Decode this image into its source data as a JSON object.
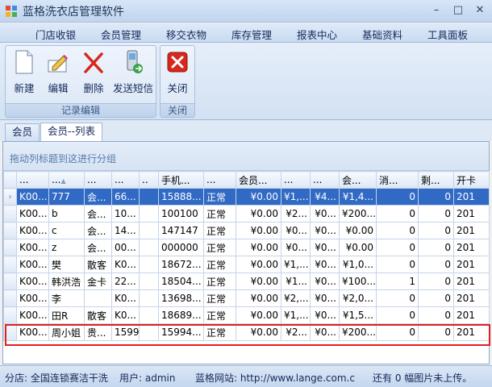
{
  "window": {
    "title": "蓝格洗衣店管理软件",
    "minimize": "–",
    "maximize": "□",
    "close": "✕"
  },
  "menu": [
    "门店收银",
    "会员管理",
    "移交衣物",
    "库存管理",
    "报表中心",
    "基础资料",
    "工具面板"
  ],
  "ribbon": {
    "groups": [
      {
        "label": "记录编辑",
        "buttons": [
          "新建",
          "编辑",
          "删除",
          "发送短信"
        ]
      },
      {
        "label": "关闭",
        "buttons": [
          "关闭"
        ]
      }
    ]
  },
  "tabs": [
    "会员",
    "会员--列表"
  ],
  "grid": {
    "group_hint": "拖动列标题到这进行分组",
    "columns": [
      "...",
      "...",
      "...",
      "...",
      "..",
      "手机...",
      "...",
      "会员...",
      "...",
      "...",
      "会...",
      "消...",
      "剩...",
      "开卡"
    ],
    "rows": [
      [
        "K00...",
        "777",
        "会...",
        "66...",
        "",
        "15888...",
        "正常",
        "¥0.00",
        "¥1,...",
        "¥4...",
        "¥1,4...",
        "0",
        "0",
        "201"
      ],
      [
        "K00...",
        "b",
        "会...",
        "10...",
        "",
        "100100",
        "正常",
        "¥0.00",
        "¥2...",
        "¥0...",
        "¥200...",
        "0",
        "0",
        "201"
      ],
      [
        "K00...",
        "c",
        "会...",
        "14...",
        "",
        "147147",
        "正常",
        "¥0.00",
        "¥0...",
        "¥0...",
        "¥0.00",
        "0",
        "0",
        "201"
      ],
      [
        "K00...",
        "z",
        "会...",
        "00...",
        "",
        "000000",
        "正常",
        "¥0.00",
        "¥0...",
        "¥0...",
        "¥0.00",
        "0",
        "0",
        "201"
      ],
      [
        "K00...",
        "樊",
        "散客",
        "K0...",
        "",
        "18672...",
        "正常",
        "¥0.00",
        "¥1,...",
        "¥0...",
        "¥1,0...",
        "0",
        "0",
        "201"
      ],
      [
        "K00...",
        "韩洪浩",
        "金卡",
        "22...",
        "",
        "18504...",
        "正常",
        "¥0.00",
        "¥1...",
        "¥0...",
        "¥100...",
        "1",
        "0",
        "201"
      ],
      [
        "K00...",
        "李",
        "",
        "K0...",
        "",
        "13698...",
        "正常",
        "¥0.00",
        "¥2,...",
        "¥0...",
        "¥2,0...",
        "0",
        "0",
        "201"
      ],
      [
        "K00...",
        "田R",
        "散客",
        "K0...",
        "",
        "18689...",
        "正常",
        "¥0.00",
        "¥1,...",
        "¥0...",
        "¥1,5...",
        "0",
        "0",
        "201"
      ],
      [
        "K00...",
        "周小姐",
        "贵...",
        "1599",
        "",
        "15994...",
        "正常",
        "¥0.00",
        "¥2...",
        "¥0...",
        "¥200...",
        "0",
        "0",
        "201"
      ]
    ]
  },
  "status": {
    "branch": "分店: 全国连锁赛洁干洗",
    "user": "用户: admin",
    "site": "蓝格网站: http://www.lange.com.c",
    "upload": "还有 0 幅图片未上传。"
  },
  "colors": {
    "selected_row": "#316ac5",
    "highlight_box": "#e02020"
  }
}
